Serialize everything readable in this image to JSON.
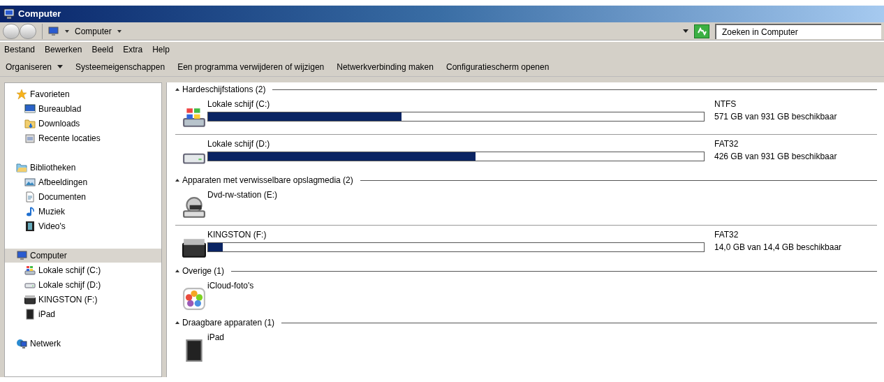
{
  "window": {
    "title": "Computer"
  },
  "address_bar": {
    "path": "Computer"
  },
  "search": {
    "placeholder": "Zoeken in Computer"
  },
  "menu": [
    "Bestand",
    "Bewerken",
    "Beeld",
    "Extra",
    "Help"
  ],
  "commands": [
    {
      "label": "Organiseren",
      "dropdown": true
    },
    {
      "label": "Systeemeigenschappen",
      "dropdown": false
    },
    {
      "label": "Een programma verwijderen of wijzigen",
      "dropdown": false
    },
    {
      "label": "Netwerkverbinding maken",
      "dropdown": false
    },
    {
      "label": "Configuratiescherm openen",
      "dropdown": false
    }
  ],
  "sidebar": {
    "groups": [
      {
        "label": "Favorieten",
        "kind": "star",
        "selected": false,
        "children": [
          {
            "label": "Bureaublad",
            "kind": "desktop",
            "selected": false
          },
          {
            "label": "Downloads",
            "kind": "folder",
            "selected": false
          },
          {
            "label": "Recente locaties",
            "kind": "recent",
            "selected": false
          }
        ]
      },
      {
        "label": "Bibliotheken",
        "kind": "library",
        "selected": false,
        "children": [
          {
            "label": "Afbeeldingen",
            "kind": "image",
            "selected": false
          },
          {
            "label": "Documenten",
            "kind": "document",
            "selected": false
          },
          {
            "label": "Muziek",
            "kind": "music",
            "selected": false
          },
          {
            "label": "Video's",
            "kind": "film",
            "selected": false
          }
        ]
      },
      {
        "label": "Computer",
        "kind": "computer",
        "selected": true,
        "children": [
          {
            "label": "Lokale schijf (C:)",
            "kind": "windrive",
            "selected": false
          },
          {
            "label": "Lokale schijf (D:)",
            "kind": "drive",
            "selected": false
          },
          {
            "label": "KINGSTON (F:)",
            "kind": "usb",
            "selected": false
          },
          {
            "label": "iPad",
            "kind": "tablet",
            "selected": false
          }
        ]
      },
      {
        "label": "Netwerk",
        "kind": "network",
        "selected": false
      }
    ]
  },
  "sections": [
    {
      "heading": "Hardeschijfstations (2)",
      "items": [
        {
          "kind": "drive",
          "name": "Lokale schijf (C:)",
          "level": 0.39,
          "filesystem": "NTFS",
          "free": "571 GB van 931 GB beschikbaar"
        },
        {
          "kind": "drive",
          "name": "Lokale schijf (D:)",
          "level": 0.54,
          "filesystem": "FAT32",
          "free": "426 GB van 931 GB beschikbaar"
        }
      ]
    },
    {
      "heading": "Apparaten met verwisselbare opslagmedia (2)",
      "items": [
        {
          "kind": "dvd",
          "name": "Dvd-rw-station (E:)"
        },
        {
          "kind": "usb",
          "name": "KINGSTON (F:)",
          "level": 0.03,
          "filesystem": "FAT32",
          "free": "14,0 GB van 14,4 GB beschikbaar"
        }
      ]
    },
    {
      "heading": "Overige (1)",
      "items": [
        {
          "kind": "photos",
          "name": "iCloud-foto's"
        }
      ]
    },
    {
      "heading": "Draagbare apparaten (1)",
      "items": [
        {
          "kind": "tablet",
          "name": "iPad"
        }
      ]
    }
  ]
}
